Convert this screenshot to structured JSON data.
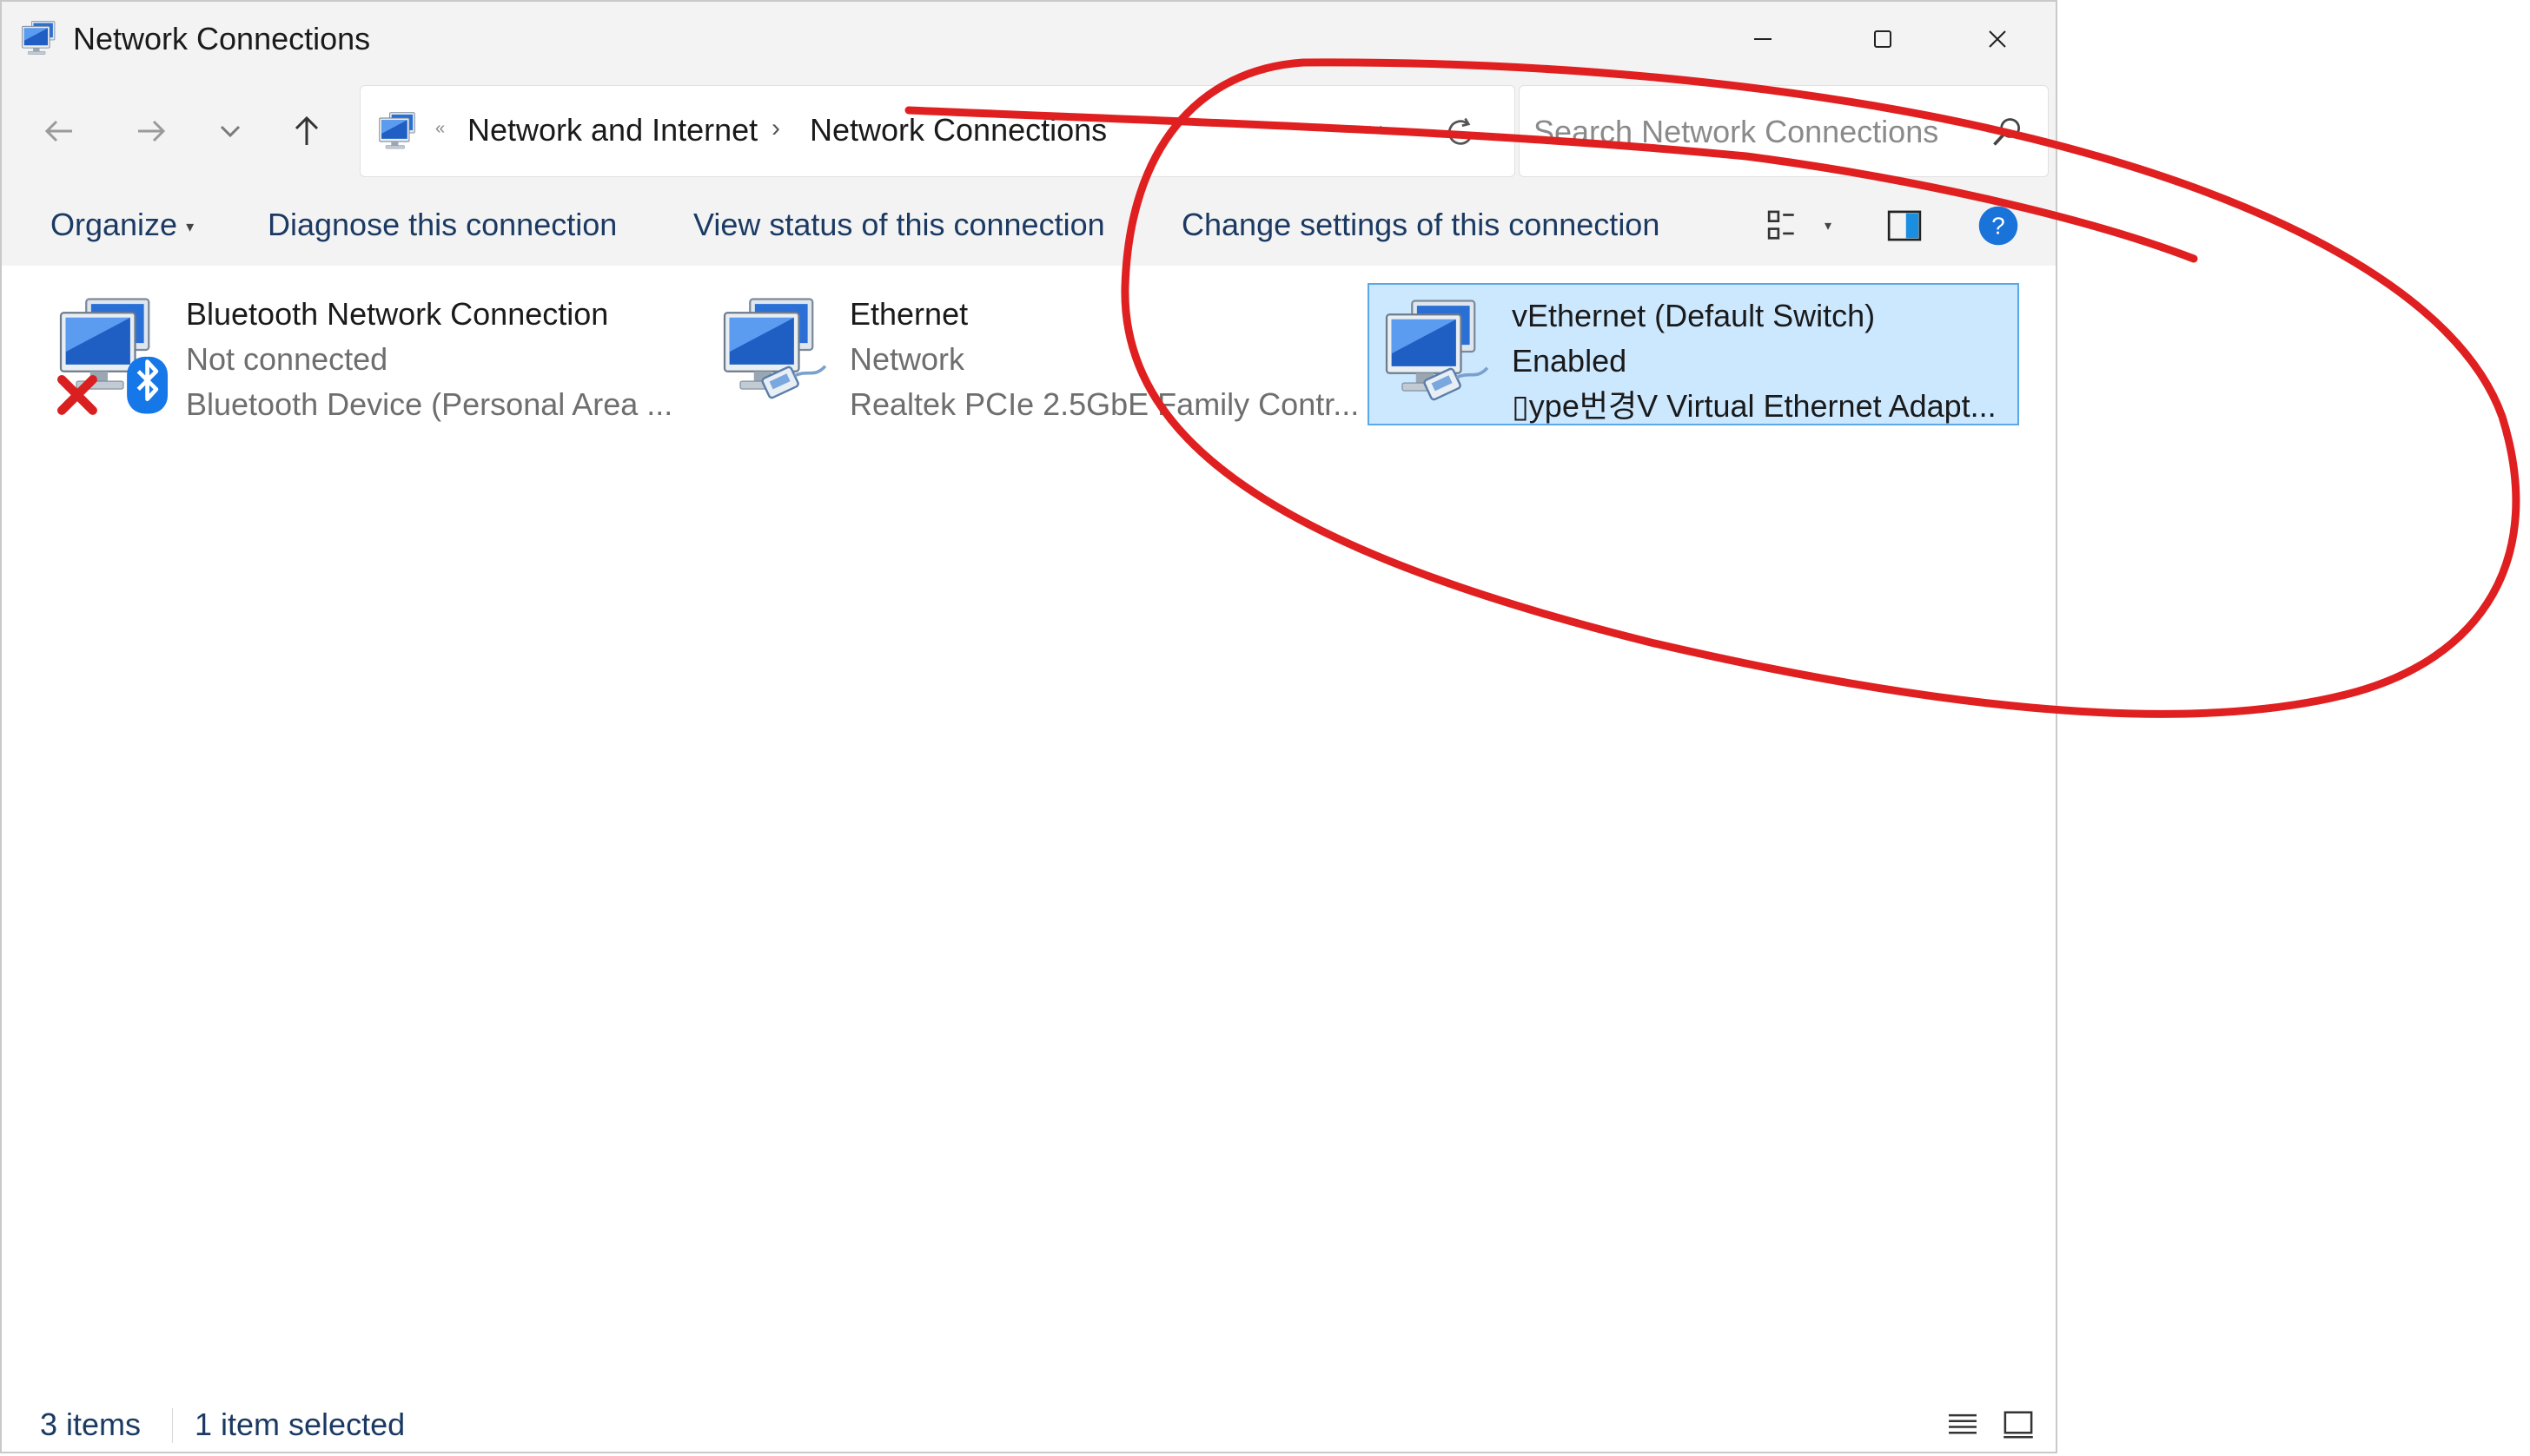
{
  "window": {
    "title": "Network Connections"
  },
  "address": {
    "crumbs": [
      "Network and Internet",
      "Network Connections"
    ],
    "chevron": "›"
  },
  "search": {
    "placeholder": "Search Network Connections",
    "value": ""
  },
  "commands": {
    "organize": "Organize",
    "diagnose": "Diagnose this connection",
    "view_status": "View status of this connection",
    "change_settings": "Change settings of this connection"
  },
  "items": [
    {
      "name": "Bluetooth Network Connection",
      "status": "Not connected",
      "device": "Bluetooth Device (Personal Area ...",
      "icon": "bluetooth-network-icon",
      "selected": false
    },
    {
      "name": "Ethernet",
      "status": "Network",
      "device": "Realtek PCIe 2.5GbE Family Contr...",
      "icon": "ethernet-network-icon",
      "selected": false
    },
    {
      "name": "vEthernet (Default Switch)",
      "status": "Enabled",
      "device": "▯ype번경V Virtual Ethernet Adapt...",
      "icon": "vethernet-network-icon",
      "selected": true
    }
  ],
  "statusbar": {
    "count": "3 items",
    "selection": "1 item selected"
  },
  "colors": {
    "chrome": "#f3f3f3",
    "selection_fill": "#cce8ff",
    "selection_border": "#5aa8e8",
    "command_text": "#1b3a63",
    "help_blue": "#1a73d9",
    "annotation_red": "#e02020"
  }
}
